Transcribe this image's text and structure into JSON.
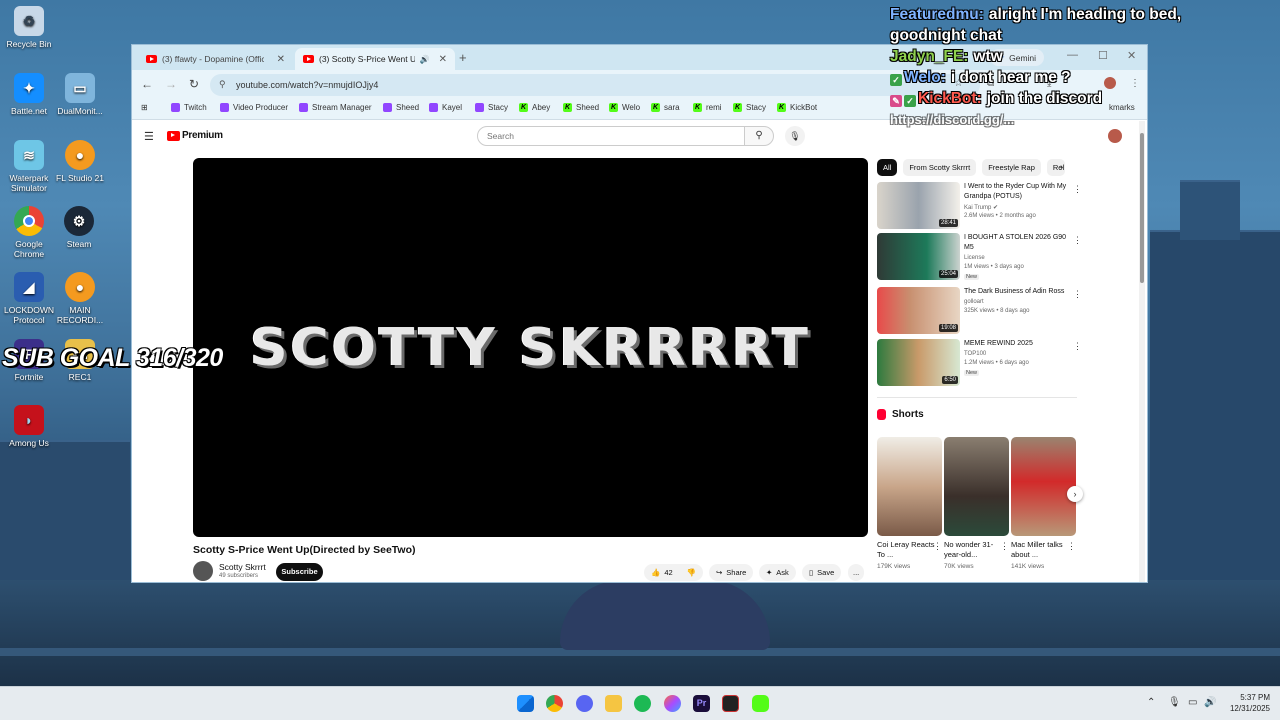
{
  "overlay": {
    "sub_goal": "SUB GOAL 316/320"
  },
  "desktop_icons": [
    {
      "label": "Recycle Bin"
    },
    {
      "label": "Battle.net"
    },
    {
      "label": "DualMonit..."
    },
    {
      "label": "Waterpark Simulator"
    },
    {
      "label": "FL Studio 21"
    },
    {
      "label": "Google Chrome"
    },
    {
      "label": "Steam"
    },
    {
      "label": "LOCKDOWN Protocol"
    },
    {
      "label": "MAIN RECORDI..."
    },
    {
      "label": "Fortnite"
    },
    {
      "label": "REC1"
    },
    {
      "label": "Among Us"
    }
  ],
  "browser": {
    "tabs": [
      {
        "title": "(3) ffawty - Dopamine (Official"
      },
      {
        "title": "(3) Scotty S-Price Went Up("
      }
    ],
    "gemini_label": "Gemini",
    "url": "youtube.com/watch?v=nmujdIOJjy4",
    "bookmarks": [
      {
        "label": "Twitch"
      },
      {
        "label": "Video Producer"
      },
      {
        "label": "Stream Manager"
      },
      {
        "label": "Sheed"
      },
      {
        "label": "Kayel"
      },
      {
        "label": "Stacy"
      },
      {
        "label": "Abey"
      },
      {
        "label": "Sheed"
      },
      {
        "label": "Welo"
      },
      {
        "label": "sara"
      },
      {
        "label": "remi"
      },
      {
        "label": "Stacy"
      },
      {
        "label": "KickBot"
      }
    ],
    "bookmarks_more": "kmarks"
  },
  "youtube": {
    "logo_text": "Premium",
    "search_placeholder": "Search",
    "player_text": "SCOTTY SKRRRRT",
    "video_title": "Scotty S-Price Went Up(Directed by SeeTwo)",
    "channel": {
      "name": "Scotty Skrrrt",
      "subs": "49 subscribers"
    },
    "subscribe_label": "Subscribe",
    "actions": {
      "likes": "42",
      "share": "Share",
      "ask": "Ask",
      "save": "Save",
      "more": "..."
    },
    "chips": [
      "All",
      "From Scotty Skrrrt",
      "Freestyle Rap",
      "Rel"
    ],
    "recommendations": [
      {
        "title": "I Went to the Ryder Cup With My Grandpa (POTUS)",
        "channel": "Kai Trump",
        "meta": "2.6M views • 2 months ago",
        "duration": "28:41",
        "badge": ""
      },
      {
        "title": "I BOUGHT A STOLEN 2026 G90 M5",
        "channel": "License",
        "meta": "1M views • 3 days ago",
        "duration": "25:04",
        "badge": "New"
      },
      {
        "title": "The Dark Business of Adin Ross",
        "channel": "golloart",
        "meta": "325K views • 8 days ago",
        "duration": "19:08",
        "badge": ""
      },
      {
        "title": "MEME REWIND 2025",
        "channel": "TOP100",
        "meta": "1.2M views • 6 days ago",
        "duration": "6:50",
        "badge": "New"
      }
    ],
    "shorts_label": "Shorts",
    "shorts": [
      {
        "title": "Coi Leray Reacts To ...",
        "views": "179K views"
      },
      {
        "title": "No wonder 31-year-old...",
        "views": "70K views"
      },
      {
        "title": "Mac Miller talks about ...",
        "views": "141K views"
      }
    ]
  },
  "chat": [
    {
      "user": "Featuredmu:",
      "user_color": "#7fb3ff",
      "message": "alright I'm heading to bed,"
    },
    {
      "user": "",
      "user_color": "#ffffff",
      "message": "goodnight chat"
    },
    {
      "user": "Jadyn_FE:",
      "user_color": "#8fd14f",
      "message": "wtw"
    },
    {
      "user": "Welo:",
      "user_color": "#7fb3ff",
      "message": "i dont hear me ?"
    },
    {
      "user": "KickBot:",
      "user_color": "#ff5a4e",
      "message": "join the discord"
    }
  ],
  "chat_link": "https://discord.gg/...",
  "taskbar": {
    "time": "5:37 PM",
    "date": "12/31/2025"
  }
}
